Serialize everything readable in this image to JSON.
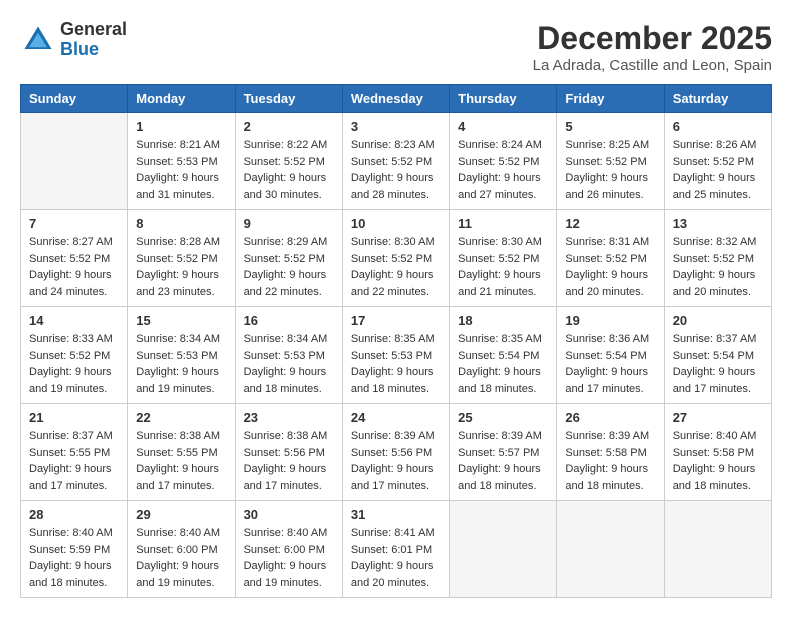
{
  "header": {
    "logo_general": "General",
    "logo_blue": "Blue",
    "month_title": "December 2025",
    "location": "La Adrada, Castille and Leon, Spain"
  },
  "weekdays": [
    "Sunday",
    "Monday",
    "Tuesday",
    "Wednesday",
    "Thursday",
    "Friday",
    "Saturday"
  ],
  "weeks": [
    [
      {
        "day": "",
        "empty": true
      },
      {
        "day": "1",
        "sunrise": "Sunrise: 8:21 AM",
        "sunset": "Sunset: 5:53 PM",
        "daylight": "Daylight: 9 hours and 31 minutes."
      },
      {
        "day": "2",
        "sunrise": "Sunrise: 8:22 AM",
        "sunset": "Sunset: 5:52 PM",
        "daylight": "Daylight: 9 hours and 30 minutes."
      },
      {
        "day": "3",
        "sunrise": "Sunrise: 8:23 AM",
        "sunset": "Sunset: 5:52 PM",
        "daylight": "Daylight: 9 hours and 28 minutes."
      },
      {
        "day": "4",
        "sunrise": "Sunrise: 8:24 AM",
        "sunset": "Sunset: 5:52 PM",
        "daylight": "Daylight: 9 hours and 27 minutes."
      },
      {
        "day": "5",
        "sunrise": "Sunrise: 8:25 AM",
        "sunset": "Sunset: 5:52 PM",
        "daylight": "Daylight: 9 hours and 26 minutes."
      },
      {
        "day": "6",
        "sunrise": "Sunrise: 8:26 AM",
        "sunset": "Sunset: 5:52 PM",
        "daylight": "Daylight: 9 hours and 25 minutes."
      }
    ],
    [
      {
        "day": "7",
        "sunrise": "Sunrise: 8:27 AM",
        "sunset": "Sunset: 5:52 PM",
        "daylight": "Daylight: 9 hours and 24 minutes."
      },
      {
        "day": "8",
        "sunrise": "Sunrise: 8:28 AM",
        "sunset": "Sunset: 5:52 PM",
        "daylight": "Daylight: 9 hours and 23 minutes."
      },
      {
        "day": "9",
        "sunrise": "Sunrise: 8:29 AM",
        "sunset": "Sunset: 5:52 PM",
        "daylight": "Daylight: 9 hours and 22 minutes."
      },
      {
        "day": "10",
        "sunrise": "Sunrise: 8:30 AM",
        "sunset": "Sunset: 5:52 PM",
        "daylight": "Daylight: 9 hours and 22 minutes."
      },
      {
        "day": "11",
        "sunrise": "Sunrise: 8:30 AM",
        "sunset": "Sunset: 5:52 PM",
        "daylight": "Daylight: 9 hours and 21 minutes."
      },
      {
        "day": "12",
        "sunrise": "Sunrise: 8:31 AM",
        "sunset": "Sunset: 5:52 PM",
        "daylight": "Daylight: 9 hours and 20 minutes."
      },
      {
        "day": "13",
        "sunrise": "Sunrise: 8:32 AM",
        "sunset": "Sunset: 5:52 PM",
        "daylight": "Daylight: 9 hours and 20 minutes."
      }
    ],
    [
      {
        "day": "14",
        "sunrise": "Sunrise: 8:33 AM",
        "sunset": "Sunset: 5:52 PM",
        "daylight": "Daylight: 9 hours and 19 minutes."
      },
      {
        "day": "15",
        "sunrise": "Sunrise: 8:34 AM",
        "sunset": "Sunset: 5:53 PM",
        "daylight": "Daylight: 9 hours and 19 minutes."
      },
      {
        "day": "16",
        "sunrise": "Sunrise: 8:34 AM",
        "sunset": "Sunset: 5:53 PM",
        "daylight": "Daylight: 9 hours and 18 minutes."
      },
      {
        "day": "17",
        "sunrise": "Sunrise: 8:35 AM",
        "sunset": "Sunset: 5:53 PM",
        "daylight": "Daylight: 9 hours and 18 minutes."
      },
      {
        "day": "18",
        "sunrise": "Sunrise: 8:35 AM",
        "sunset": "Sunset: 5:54 PM",
        "daylight": "Daylight: 9 hours and 18 minutes."
      },
      {
        "day": "19",
        "sunrise": "Sunrise: 8:36 AM",
        "sunset": "Sunset: 5:54 PM",
        "daylight": "Daylight: 9 hours and 17 minutes."
      },
      {
        "day": "20",
        "sunrise": "Sunrise: 8:37 AM",
        "sunset": "Sunset: 5:54 PM",
        "daylight": "Daylight: 9 hours and 17 minutes."
      }
    ],
    [
      {
        "day": "21",
        "sunrise": "Sunrise: 8:37 AM",
        "sunset": "Sunset: 5:55 PM",
        "daylight": "Daylight: 9 hours and 17 minutes."
      },
      {
        "day": "22",
        "sunrise": "Sunrise: 8:38 AM",
        "sunset": "Sunset: 5:55 PM",
        "daylight": "Daylight: 9 hours and 17 minutes."
      },
      {
        "day": "23",
        "sunrise": "Sunrise: 8:38 AM",
        "sunset": "Sunset: 5:56 PM",
        "daylight": "Daylight: 9 hours and 17 minutes."
      },
      {
        "day": "24",
        "sunrise": "Sunrise: 8:39 AM",
        "sunset": "Sunset: 5:56 PM",
        "daylight": "Daylight: 9 hours and 17 minutes."
      },
      {
        "day": "25",
        "sunrise": "Sunrise: 8:39 AM",
        "sunset": "Sunset: 5:57 PM",
        "daylight": "Daylight: 9 hours and 18 minutes."
      },
      {
        "day": "26",
        "sunrise": "Sunrise: 8:39 AM",
        "sunset": "Sunset: 5:58 PM",
        "daylight": "Daylight: 9 hours and 18 minutes."
      },
      {
        "day": "27",
        "sunrise": "Sunrise: 8:40 AM",
        "sunset": "Sunset: 5:58 PM",
        "daylight": "Daylight: 9 hours and 18 minutes."
      }
    ],
    [
      {
        "day": "28",
        "sunrise": "Sunrise: 8:40 AM",
        "sunset": "Sunset: 5:59 PM",
        "daylight": "Daylight: 9 hours and 18 minutes."
      },
      {
        "day": "29",
        "sunrise": "Sunrise: 8:40 AM",
        "sunset": "Sunset: 6:00 PM",
        "daylight": "Daylight: 9 hours and 19 minutes."
      },
      {
        "day": "30",
        "sunrise": "Sunrise: 8:40 AM",
        "sunset": "Sunset: 6:00 PM",
        "daylight": "Daylight: 9 hours and 19 minutes."
      },
      {
        "day": "31",
        "sunrise": "Sunrise: 8:41 AM",
        "sunset": "Sunset: 6:01 PM",
        "daylight": "Daylight: 9 hours and 20 minutes."
      },
      {
        "day": "",
        "empty": true
      },
      {
        "day": "",
        "empty": true
      },
      {
        "day": "",
        "empty": true
      }
    ]
  ]
}
